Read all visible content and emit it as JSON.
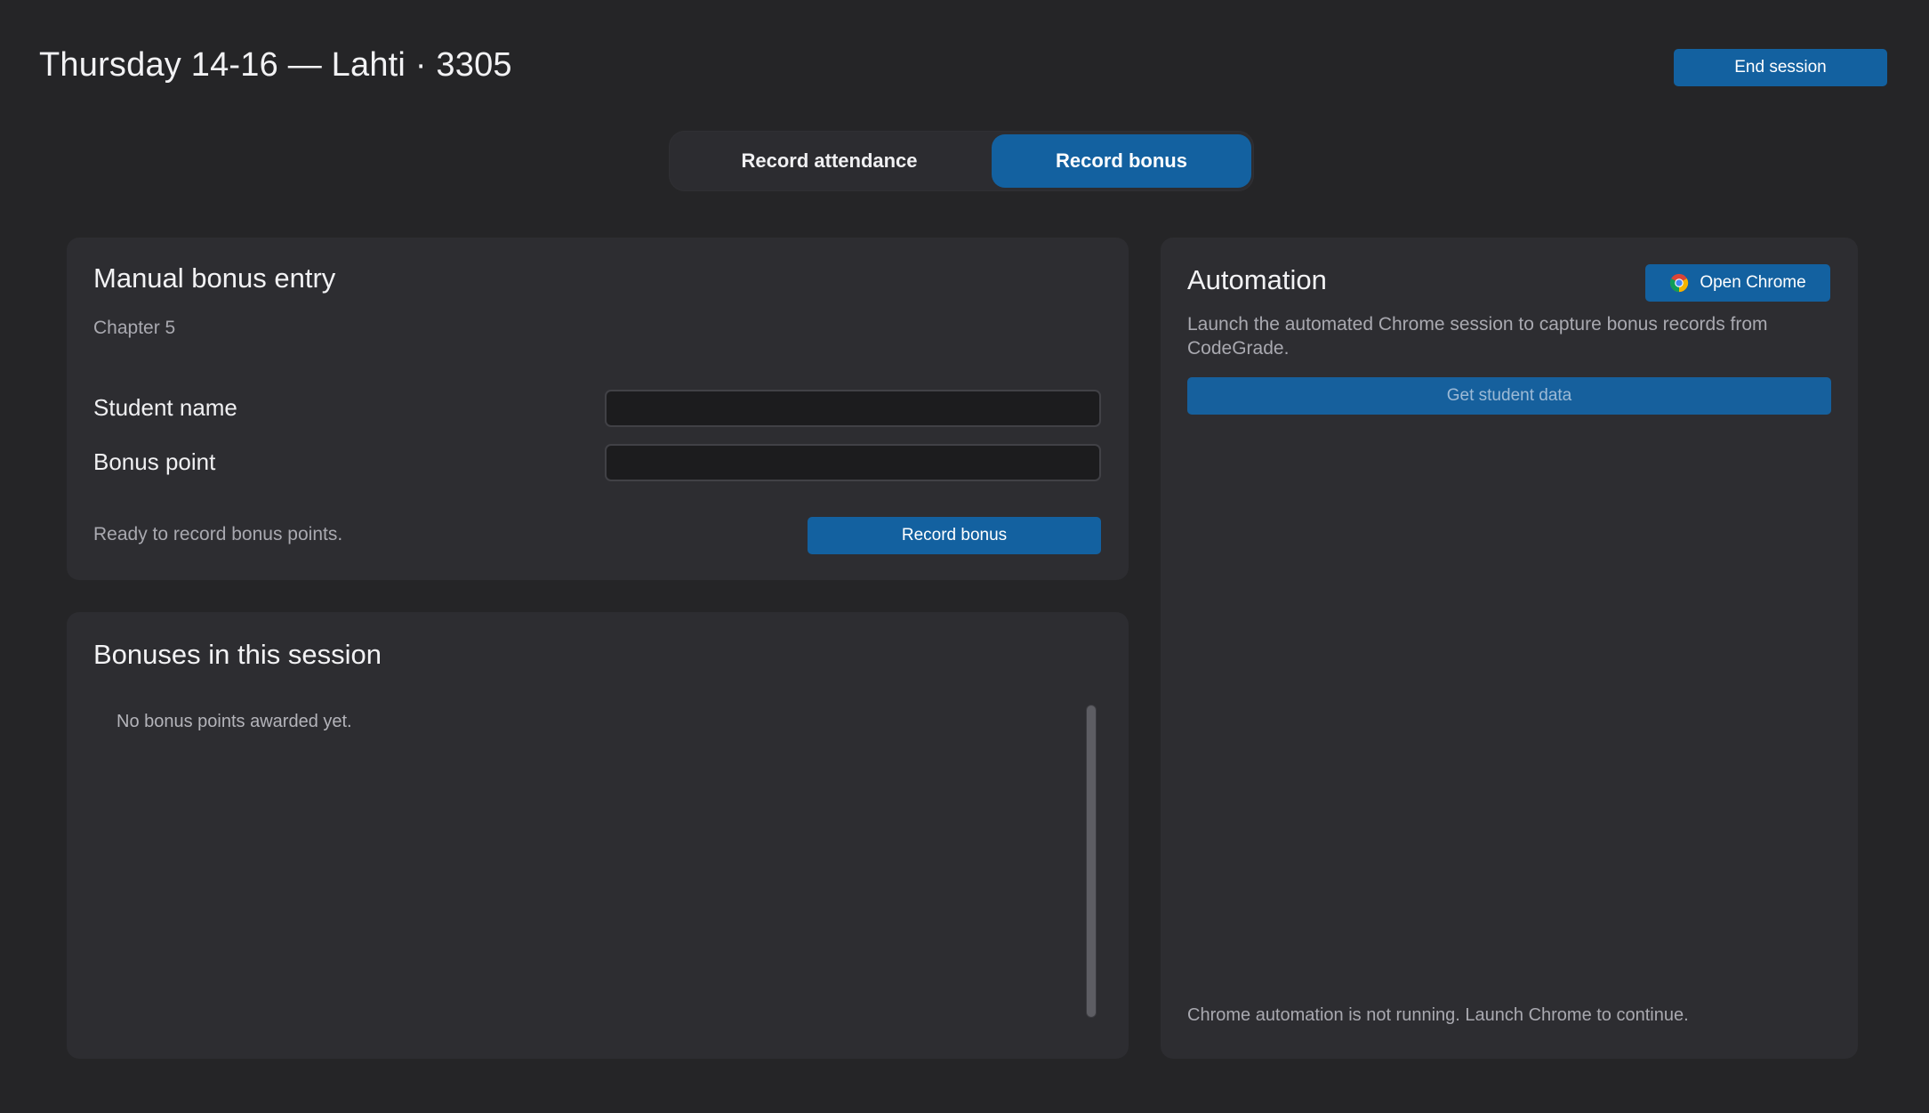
{
  "header": {
    "title": "Thursday 14-16 — Lahti · 3305",
    "end_session_label": "End session"
  },
  "tabs": [
    {
      "label": "Record attendance",
      "active": false
    },
    {
      "label": "Record bonus",
      "active": true
    }
  ],
  "manual_entry": {
    "title": "Manual bonus entry",
    "subtitle": "Chapter 5",
    "student_name_label": "Student name",
    "student_name_value": "",
    "bonus_point_label": "Bonus point",
    "bonus_point_value": "",
    "status": "Ready to record bonus points.",
    "submit_label": "Record bonus"
  },
  "bonuses": {
    "title": "Bonuses in this session",
    "empty_message": "No bonus points awarded yet.",
    "items": []
  },
  "automation": {
    "title": "Automation",
    "open_chrome_label": "Open Chrome",
    "open_chrome_icon": "chrome-icon",
    "description": "Launch the automated Chrome session to capture bonus records from CodeGrade.",
    "get_data_label": "Get student data",
    "get_data_enabled": false,
    "status": "Chrome automation is not running. Launch Chrome to continue."
  },
  "colors": {
    "background": "#252527",
    "card": "#2d2d31",
    "accent": "#1361a0",
    "input_bg": "#1c1c1e",
    "muted_text": "#a9a9b0"
  }
}
